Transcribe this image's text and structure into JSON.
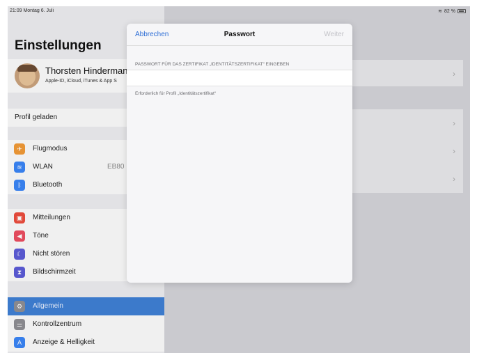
{
  "status": {
    "time_date": "21:09  Montag 6. Juli",
    "battery": "82 %"
  },
  "sidebar": {
    "title": "Einstellungen",
    "profile": {
      "name": "Thorsten Hinderman",
      "subtitle": "Apple-ID, iCloud, iTunes & App S"
    },
    "profil_geladen": "Profil geladen",
    "items": [
      {
        "label": "Flugmodus",
        "icon": "airplane-icon",
        "color": "#f09a37"
      },
      {
        "label": "WLAN",
        "value": "EB80",
        "icon": "wifi-icon",
        "color": "#3a85f5"
      },
      {
        "label": "Bluetooth",
        "icon": "bluetooth-icon",
        "color": "#3a85f5"
      },
      {
        "label": "Mitteilungen",
        "icon": "notifications-icon",
        "color": "#eb4d3d"
      },
      {
        "label": "Töne",
        "icon": "sound-icon",
        "color": "#eb4d5f"
      },
      {
        "label": "Nicht stören",
        "icon": "moon-icon",
        "color": "#5b5bd6"
      },
      {
        "label": "Bildschirmzeit",
        "icon": "hourglass-icon",
        "color": "#5b5bd6"
      },
      {
        "label": "Allgemein",
        "icon": "gear-icon",
        "color": "#8e8e93"
      },
      {
        "label": "Kontrollzentrum",
        "icon": "switches-icon",
        "color": "#8e8e93"
      },
      {
        "label": "Anzeige & Helligkeit",
        "icon": "display-icon",
        "color": "#3a85f5"
      }
    ]
  },
  "modal": {
    "cancel_label": "Abbrechen",
    "title": "Passwort",
    "next_label": "Weiter",
    "section_header": "PASSWORT FÜR DAS ZERTIFIKAT „IDENTITÄTSZERTIFIKAT“ EINGEBEN",
    "input_value": "",
    "section_footer": "Erforderlich für Profil „Identitätszertifikat“"
  }
}
